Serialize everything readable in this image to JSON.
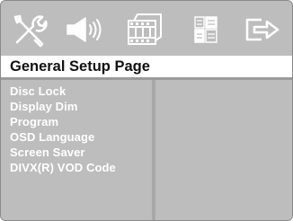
{
  "icons": [
    {
      "name": "settings-tools-icon"
    },
    {
      "name": "audio-speaker-icon"
    },
    {
      "name": "video-film-icon"
    },
    {
      "name": "preferences-grid-icon"
    },
    {
      "name": "exit-icon"
    }
  ],
  "header": {
    "title": "General Setup Page"
  },
  "menu": {
    "items": [
      {
        "label": "Disc Lock"
      },
      {
        "label": "Display Dim"
      },
      {
        "label": "Program"
      },
      {
        "label": "OSD Language"
      },
      {
        "label": "Screen Saver"
      },
      {
        "label": "DIVX(R) VOD Code"
      }
    ]
  },
  "colors": {
    "panel": "#bdbdbd",
    "header_bg": "#ffffff",
    "menu_text": "#ffffff",
    "title_text": "#111111"
  }
}
